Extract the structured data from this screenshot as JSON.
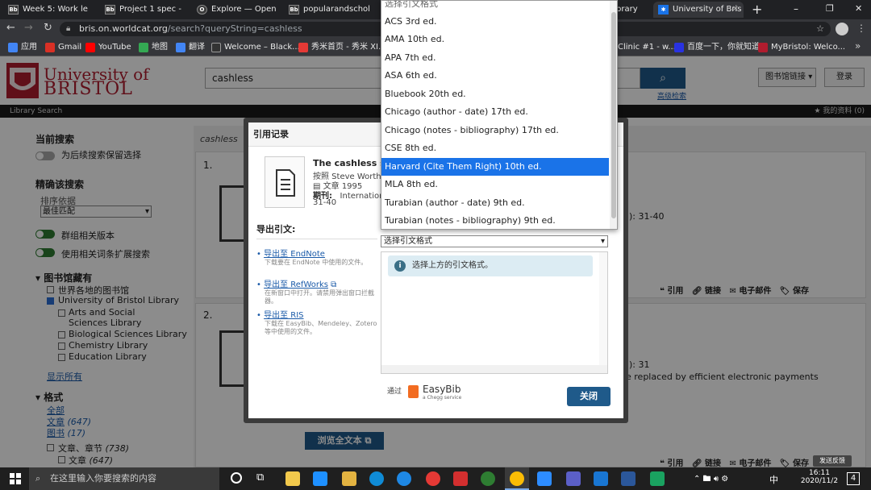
{
  "browser": {
    "tabs": [
      {
        "icon": "Bb",
        "title": "Week 5: Work le"
      },
      {
        "icon": "Bb",
        "title": "Project 1 spec -"
      },
      {
        "icon": "O",
        "title": "Explore — Open"
      },
      {
        "icon": "Bb",
        "title": "popularandschol"
      },
      {
        "icon": "W",
        "title": "University of Bris",
        "active": true
      }
    ],
    "tab_partial": "brary",
    "url_host": "bris.on.worldcat.org",
    "url_path": "/search?queryString=cashless",
    "bookmarks": [
      "应用",
      "Gmail",
      "YouTube",
      "地图",
      "翻译",
      "Welcome – Black...",
      "秀米首页 - 秀米 XI...",
      "Clinic #1 - w...",
      "百度一下，你就知道",
      "MyBristol: Welco..."
    ],
    "colors": {
      "gmail": "#d93025",
      "youtube": "#ff0000",
      "maps": "#34a853",
      "translate": "#4285f4"
    }
  },
  "page": {
    "logo_line1": "University of",
    "logo_line2": "BRISTOL",
    "search_value": "cashless",
    "advanced_search": "高级检索",
    "library_link_button": "图书馆链接",
    "login_button": "登录",
    "library_search": "Library Search",
    "my_account": "我的资料 (0)",
    "query_label": "cashless"
  },
  "sidebar": {
    "current_search": "当前搜索",
    "keep_selection": "为后续搜索保留选择",
    "refine": "精确该搜索",
    "sort_by": "排序依据",
    "sort_value": "最佳匹配",
    "group_versions": "群组相关版本",
    "use_terms": "使用相关词条扩展搜索",
    "library_holdings": "图书馆藏有",
    "libraries": [
      "世界各地的图书馆",
      "University of Bristol Library"
    ],
    "sublibraries": [
      "Arts and Social Sciences Library",
      "Biological Sciences Library",
      "Chemistry Library",
      "Education Library"
    ],
    "show_all": "显示所有",
    "format_heading": "格式",
    "format_all": "全部",
    "format_text": "文章",
    "format_text_count": "(647)",
    "format_book": "图书",
    "format_book_count": "(17)",
    "format_articles_chapters": "文章、章节",
    "format_articles_chapters_count": "(738)",
    "format_articles": "文章",
    "format_articles_count": "(647)"
  },
  "results": {
    "r1_num": "1.",
    "r2_num": "2.",
    "r1_pages": "): 31-40",
    "r2_pages": "): 31",
    "r2_snippet": "e replaced by efficient electronic payments",
    "actions": [
      "引用",
      "链接",
      "电子邮件",
      "保存"
    ],
    "full_text_button": "浏览全文本"
  },
  "modal": {
    "title": "引用记录",
    "item_title": "The cashless so",
    "item_author": "按照 Steve Worthir",
    "item_type": "文章 1995",
    "item_journal_label": "期刊:",
    "item_journal": "International",
    "item_pages": "31-40",
    "export_heading": "导出引文:",
    "exports": [
      {
        "label": "导出至 EndNote",
        "desc": "下载要在 EndNote 中使用的文件。"
      },
      {
        "label": "导出至 RefWorks",
        "desc": "在新窗口中打开。请禁用弹出窗口拦截器。"
      },
      {
        "label": "导出至 RIS",
        "desc": "下载在 EasyBib、Mendeley、Zotero 等中使用的文件。"
      }
    ],
    "select_placeholder": "选择引文格式",
    "info_message": "选择上方的引文格式。",
    "via": "通过",
    "easybib": "EasyBib",
    "easybib_sub": "a Chegg service",
    "close_button": "关闭"
  },
  "dropdown": {
    "options": [
      "选择引文格式",
      "ACS 3rd ed.",
      "AMA 10th ed.",
      "APA 7th ed.",
      "ASA 6th ed.",
      "Bluebook 20th ed.",
      "Chicago (author - date) 17th ed.",
      "Chicago (notes - bibliography) 17th ed.",
      "CSE 8th ed.",
      "Harvard (Cite Them Right) 10th ed.",
      "MLA 8th ed.",
      "Turabian (author - date) 9th ed.",
      "Turabian (notes - bibliography) 9th ed."
    ],
    "selected_index": 9
  },
  "taskbar": {
    "search_placeholder": "在这里输入你要搜索的内容",
    "time": "16:11",
    "date": "2020/11/2",
    "ime": "中",
    "feedback": "发送反馈",
    "notifications": "4"
  }
}
